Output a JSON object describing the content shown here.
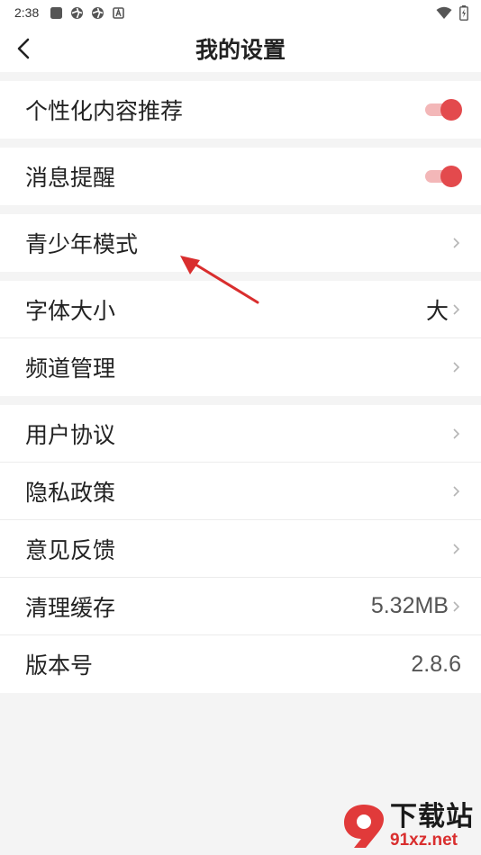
{
  "status_bar": {
    "time": "2:38",
    "left_icons": [
      "app-square-icon",
      "aperture-icon",
      "aperture-icon",
      "a-badge-icon"
    ],
    "right_icons": [
      "wifi-icon",
      "battery-icon"
    ]
  },
  "header": {
    "title": "我的设置",
    "back_icon": "chevron-left-icon"
  },
  "groups": [
    [
      {
        "label": "个性化内容推荐",
        "control": "toggle",
        "on": true
      }
    ],
    [
      {
        "label": "消息提醒",
        "control": "toggle",
        "on": true
      }
    ],
    [
      {
        "label": "青少年模式",
        "control": "chevron"
      }
    ],
    [
      {
        "label": "字体大小",
        "value": "大",
        "control": "chevron"
      },
      {
        "label": "频道管理",
        "control": "chevron"
      }
    ],
    [
      {
        "label": "用户协议",
        "control": "chevron"
      },
      {
        "label": "隐私政策",
        "control": "chevron"
      },
      {
        "label": "意见反馈",
        "control": "chevron"
      },
      {
        "label": "清理缓存",
        "value": "5.32MB",
        "control": "chevron"
      },
      {
        "label": "版本号",
        "value": "2.8.6",
        "control": "none"
      }
    ]
  ],
  "colors": {
    "accent": "#e34a4d",
    "toggle_track": "#f3b7b8",
    "background": "#f4f4f4",
    "annotation_arrow": "#d92e2e"
  },
  "watermark": {
    "logo_text": "9",
    "text_cn": "下载站",
    "text_en": "91xz.net"
  }
}
